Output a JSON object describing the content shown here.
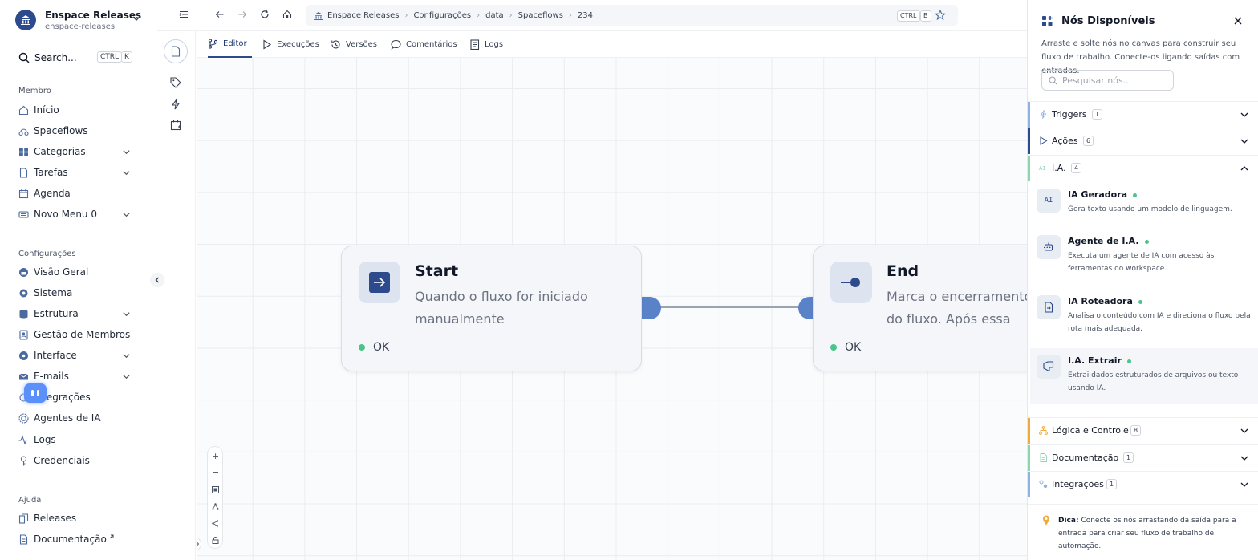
{
  "workspace": {
    "name": "Enspace Releases",
    "slug": "enspace-releases"
  },
  "search": {
    "label": "Search...",
    "kbd": [
      "CTRL",
      "K"
    ]
  },
  "nav": {
    "member_title": "Membro",
    "member_items": [
      {
        "label": "Início",
        "icon": "home-icon"
      },
      {
        "label": "Spaceflows",
        "icon": "spaceflows-icon"
      },
      {
        "label": "Categorias",
        "icon": "grid-icon"
      },
      {
        "label": "Tarefas",
        "icon": "file-icon"
      },
      {
        "label": "Agenda",
        "icon": "calendar-icon"
      },
      {
        "label": "Novo Menu 0",
        "icon": "keyboard-icon"
      }
    ],
    "config_title": "Configurações",
    "config_items": [
      {
        "label": "Visão Geral",
        "icon": "dashboard-icon"
      },
      {
        "label": "Sistema",
        "icon": "gear-icon"
      },
      {
        "label": "Estrutura",
        "icon": "database-icon"
      },
      {
        "label": "Gestão de Membros",
        "icon": "members-icon"
      },
      {
        "label": "Interface",
        "icon": "palette-icon"
      },
      {
        "label": "E-mails",
        "icon": "mail-icon"
      },
      {
        "label": "Integrações",
        "icon": "plug-icon"
      },
      {
        "label": "Agentes de IA",
        "icon": "chip-icon"
      },
      {
        "label": "Logs",
        "icon": "activity-icon"
      },
      {
        "label": "Credenciais",
        "icon": "key-icon"
      }
    ],
    "help_title": "Ajuda",
    "help_items": [
      {
        "label": "Releases",
        "icon": "releases-icon"
      },
      {
        "label": "Documentação",
        "icon": "doc-icon"
      }
    ]
  },
  "breadcrumb": {
    "items": [
      "Enspace Releases",
      "Configurações",
      "data",
      "Spaceflows",
      "234"
    ],
    "kbd": [
      "CTRL",
      "B"
    ]
  },
  "tabs": [
    "Editor",
    "Execuções",
    "Versões",
    "Comentários",
    "Logs"
  ],
  "nodes": {
    "start": {
      "title": "Start",
      "desc": "Quando o fluxo for iniciado manualmente",
      "status": "OK"
    },
    "end": {
      "title": "End",
      "desc": "Marca o encerramento do fluxo. Após essa etapa, nenhuma",
      "status": "OK"
    }
  },
  "panel": {
    "title": "Nós Disponíveis",
    "desc": "Arraste e solte nós no canvas para construir seu fluxo de trabalho. Conecte-os ligando saídas com entradas.",
    "search_placeholder": "Pesquisar nós...",
    "categories": [
      {
        "label": "Triggers",
        "count": "1",
        "color": "#8fb1e0"
      },
      {
        "label": "Ações",
        "count": "6",
        "color": "#2c4a8c"
      },
      {
        "label": "I.A.",
        "count": "4",
        "color": "#8fd3b0",
        "ai_glyph": "AI"
      }
    ],
    "ai_items": [
      {
        "title": "IA Geradora",
        "desc": "Gera texto usando um modelo de linguagem.",
        "glyph": "AI"
      },
      {
        "title": "Agente de I.A.",
        "desc": "Executa um agente de IA com acesso às ferramentas do workspace."
      },
      {
        "title": "IA Roteadora",
        "desc": "Analisa o conteúdo com IA e direciona o fluxo pela rota mais adequada."
      },
      {
        "title": "I.A. Extrair",
        "desc": "Extrai dados estruturados de arquivos ou texto usando IA."
      }
    ],
    "categories_bottom": [
      {
        "label": "Lógica e Controle",
        "count": "8",
        "color": "#f0a93b"
      },
      {
        "label": "Documentação",
        "count": "1",
        "color": "#8fd3b0"
      },
      {
        "label": "Integrações",
        "count": "1",
        "color": "#8fb1e0"
      }
    ],
    "tip_label": "Dica:",
    "tip_text": " Conecte os nós arrastando da saída para a entrada para criar seu fluxo de trabalho de automação."
  }
}
